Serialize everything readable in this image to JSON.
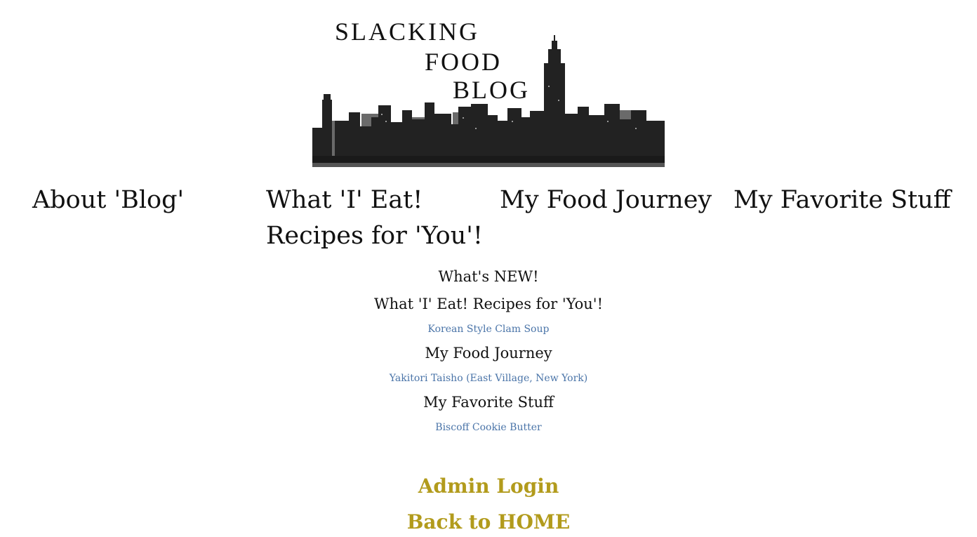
{
  "logo": {
    "line1": "SLACKING",
    "line2": "FOOD",
    "line3": "BLOG"
  },
  "nav": {
    "about": "About 'Blog'",
    "eat_line1": "What 'I' Eat!",
    "eat_line2": "Recipes for 'You'!",
    "journey": "My Food Journey",
    "favorite": "My Favorite Stuff"
  },
  "news": {
    "whats_new": "What's NEW!",
    "sections": [
      {
        "heading": "What 'I' Eat! Recipes for 'You'!",
        "post": "Korean Style Clam Soup"
      },
      {
        "heading": "My Food Journey",
        "post": "Yakitori Taisho (East Village, New York)"
      },
      {
        "heading": "My Favorite Stuff",
        "post": "Biscoff Cookie Butter"
      }
    ]
  },
  "footer": {
    "admin_login": "Admin Login",
    "back_home": "Back to HOME"
  },
  "colors": {
    "post_link": "#4a74a8",
    "footer_link": "#b29b1c",
    "text": "#111111"
  }
}
